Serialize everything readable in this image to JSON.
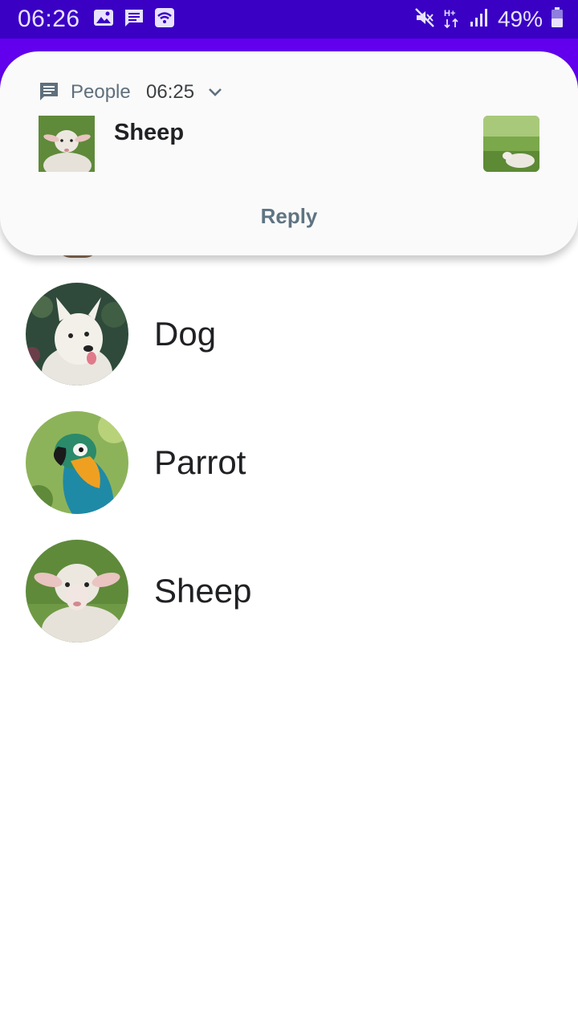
{
  "status_bar": {
    "time": "06:26",
    "battery_percent": "49%",
    "network": "H+",
    "icons_left": [
      "image-icon",
      "message-icon",
      "wifi-call-icon"
    ],
    "icons_right": [
      "mute-icon",
      "data-hplus-icon",
      "signal-icon",
      "battery-icon"
    ],
    "bar_color": "#3A00C4"
  },
  "app_bar": {
    "color": "#6200EE"
  },
  "notification": {
    "app_name": "People",
    "time": "06:25",
    "title": "Sheep",
    "action_reply": "Reply",
    "icon": "message-icon"
  },
  "contacts": [
    {
      "name": "Dog",
      "avatar": "dog-avatar"
    },
    {
      "name": "Parrot",
      "avatar": "parrot-avatar"
    },
    {
      "name": "Sheep",
      "avatar": "sheep-avatar"
    }
  ]
}
